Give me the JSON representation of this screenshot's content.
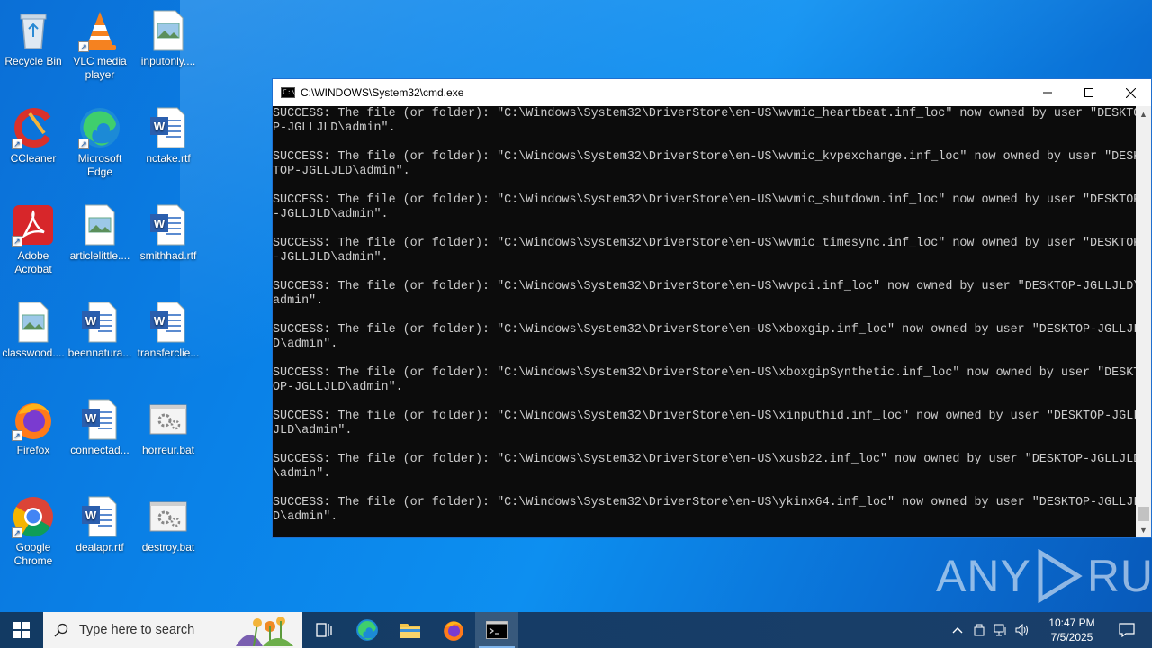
{
  "desktop": {
    "icons": [
      {
        "label": "Recycle Bin",
        "icon": "recycle-bin-icon"
      },
      {
        "label": "VLC media player",
        "icon": "vlc-icon"
      },
      {
        "label": "inputonly....",
        "icon": "image-file-icon"
      },
      {
        "label": "CCleaner",
        "icon": "ccleaner-icon"
      },
      {
        "label": "Microsoft Edge",
        "icon": "edge-icon"
      },
      {
        "label": "nctake.rtf",
        "icon": "word-doc-icon"
      },
      {
        "label": "Adobe Acrobat",
        "icon": "acrobat-icon"
      },
      {
        "label": "articlelittle....",
        "icon": "image-file-icon"
      },
      {
        "label": "smithhad.rtf",
        "icon": "word-doc-icon"
      },
      {
        "label": "classwood....",
        "icon": "image-file-icon"
      },
      {
        "label": "beennatura...",
        "icon": "word-doc-icon"
      },
      {
        "label": "transferclie...",
        "icon": "word-doc-icon"
      },
      {
        "label": "Firefox",
        "icon": "firefox-icon"
      },
      {
        "label": "connectad...",
        "icon": "word-doc-icon"
      },
      {
        "label": "horreur.bat",
        "icon": "bat-file-icon"
      },
      {
        "label": "Google Chrome",
        "icon": "chrome-icon"
      },
      {
        "label": "dealapr.rtf",
        "icon": "word-doc-icon"
      },
      {
        "label": "destroy.bat",
        "icon": "bat-file-icon"
      }
    ]
  },
  "cmd": {
    "title": "C:\\WINDOWS\\System32\\cmd.exe",
    "lines": [
      "SUCCESS: The file (or folder): \"C:\\Windows\\System32\\DriverStore\\en-US\\wvmic_heartbeat.inf_loc\" now owned by user \"DESKTO",
      "P-JGLLJLD\\admin\".",
      "",
      "SUCCESS: The file (or folder): \"C:\\Windows\\System32\\DriverStore\\en-US\\wvmic_kvpexchange.inf_loc\" now owned by user \"DESK",
      "TOP-JGLLJLD\\admin\".",
      "",
      "SUCCESS: The file (or folder): \"C:\\Windows\\System32\\DriverStore\\en-US\\wvmic_shutdown.inf_loc\" now owned by user \"DESKTOP",
      "-JGLLJLD\\admin\".",
      "",
      "SUCCESS: The file (or folder): \"C:\\Windows\\System32\\DriverStore\\en-US\\wvmic_timesync.inf_loc\" now owned by user \"DESKTOP",
      "-JGLLJLD\\admin\".",
      "",
      "SUCCESS: The file (or folder): \"C:\\Windows\\System32\\DriverStore\\en-US\\wvpci.inf_loc\" now owned by user \"DESKTOP-JGLLJLD\\",
      "admin\".",
      "",
      "SUCCESS: The file (or folder): \"C:\\Windows\\System32\\DriverStore\\en-US\\xboxgip.inf_loc\" now owned by user \"DESKTOP-JGLLJL",
      "D\\admin\".",
      "",
      "SUCCESS: The file (or folder): \"C:\\Windows\\System32\\DriverStore\\en-US\\xboxgipSynthetic.inf_loc\" now owned by user \"DESKT",
      "OP-JGLLJLD\\admin\".",
      "",
      "SUCCESS: The file (or folder): \"C:\\Windows\\System32\\DriverStore\\en-US\\xinputhid.inf_loc\" now owned by user \"DESKTOP-JGLL",
      "JLD\\admin\".",
      "",
      "SUCCESS: The file (or folder): \"C:\\Windows\\System32\\DriverStore\\en-US\\xusb22.inf_loc\" now owned by user \"DESKTOP-JGLLJLD",
      "\\admin\".",
      "",
      "SUCCESS: The file (or folder): \"C:\\Windows\\System32\\DriverStore\\en-US\\ykinx64.inf_loc\" now owned by user \"DESKTOP-JGLLJL",
      "D\\admin\"."
    ]
  },
  "watermark": {
    "left": "ANY",
    "right": "RUN"
  },
  "taskbar": {
    "search_placeholder": "Type here to search",
    "clock_time": "10:47 PM",
    "clock_date": "7/5/2025"
  }
}
